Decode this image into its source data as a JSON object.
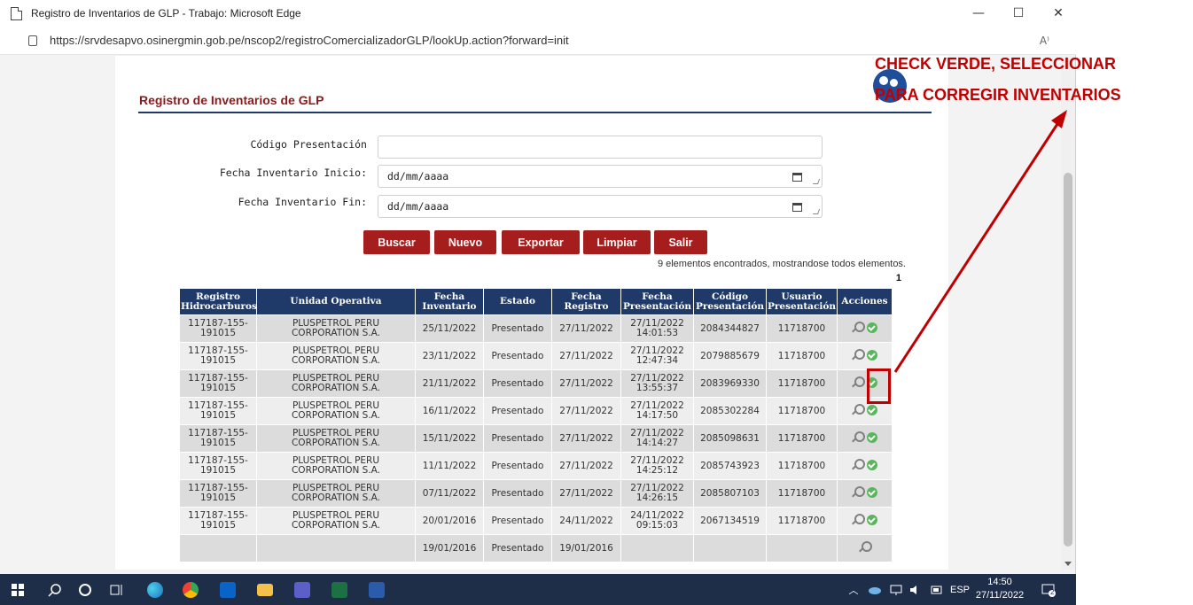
{
  "window": {
    "title": "Registro de Inventarios de GLP - Trabajo: Microsoft Edge",
    "url": "https://srvdesapvo.osinergmin.gob.pe/nscop2/registroComercializadorGLP/lookUp.action?forward=init",
    "minimize": "—",
    "maximize": "☐",
    "close": "✕",
    "read_aloud": "A⁾"
  },
  "page": {
    "heading": "Registro de Inventarios de GLP",
    "form": {
      "codigo_label": "Código Presentación",
      "codigo_value": "",
      "inicio_label": "Fecha Inventario Inicio:",
      "inicio_value": "dd/mm/aaaa",
      "fin_label": "Fecha Inventario Fin:",
      "fin_value": "dd/mm/aaaa"
    },
    "buttons": {
      "buscar": "Buscar",
      "nuevo": "Nuevo",
      "exportar": "Exportar",
      "limpiar": "Limpiar",
      "salir": "Salir"
    },
    "results_message": "9 elementos encontrados, mostrandose todos elementos.",
    "page_number": "1",
    "table": {
      "headers": [
        "Registro Hidrocarburos",
        "Unidad Operativa",
        "Fecha Inventario",
        "Estado",
        "Fecha Registro",
        "Fecha Presentación",
        "Código Presentación",
        "Usuario Presentación",
        "Acciones"
      ],
      "rows": [
        {
          "registro": "117187-155-191015",
          "unidad": "PLUSPETROL PERU CORPORATION S.A.",
          "fecha_inv": "25/11/2022",
          "estado": "Presentado",
          "fecha_reg": "27/11/2022",
          "fecha_pres": "27/11/2022 14:01:53",
          "codigo": "2084344827",
          "usuario": "11718700"
        },
        {
          "registro": "117187-155-191015",
          "unidad": "PLUSPETROL PERU CORPORATION S.A.",
          "fecha_inv": "23/11/2022",
          "estado": "Presentado",
          "fecha_reg": "27/11/2022",
          "fecha_pres": "27/11/2022 12:47:34",
          "codigo": "2079885679",
          "usuario": "11718700"
        },
        {
          "registro": "117187-155-191015",
          "unidad": "PLUSPETROL PERU CORPORATION S.A.",
          "fecha_inv": "21/11/2022",
          "estado": "Presentado",
          "fecha_reg": "27/11/2022",
          "fecha_pres": "27/11/2022 13:55:37",
          "codigo": "2083969330",
          "usuario": "11718700"
        },
        {
          "registro": "117187-155-191015",
          "unidad": "PLUSPETROL PERU CORPORATION S.A.",
          "fecha_inv": "16/11/2022",
          "estado": "Presentado",
          "fecha_reg": "27/11/2022",
          "fecha_pres": "27/11/2022 14:17:50",
          "codigo": "2085302284",
          "usuario": "11718700"
        },
        {
          "registro": "117187-155-191015",
          "unidad": "PLUSPETROL PERU CORPORATION S.A.",
          "fecha_inv": "15/11/2022",
          "estado": "Presentado",
          "fecha_reg": "27/11/2022",
          "fecha_pres": "27/11/2022 14:14:27",
          "codigo": "2085098631",
          "usuario": "11718700"
        },
        {
          "registro": "117187-155-191015",
          "unidad": "PLUSPETROL PERU CORPORATION S.A.",
          "fecha_inv": "11/11/2022",
          "estado": "Presentado",
          "fecha_reg": "27/11/2022",
          "fecha_pres": "27/11/2022 14:25:12",
          "codigo": "2085743923",
          "usuario": "11718700"
        },
        {
          "registro": "117187-155-191015",
          "unidad": "PLUSPETROL PERU CORPORATION S.A.",
          "fecha_inv": "07/11/2022",
          "estado": "Presentado",
          "fecha_reg": "27/11/2022",
          "fecha_pres": "27/11/2022 14:26:15",
          "codigo": "2085807103",
          "usuario": "11718700"
        },
        {
          "registro": "117187-155-191015",
          "unidad": "PLUSPETROL PERU CORPORATION S.A.",
          "fecha_inv": "20/01/2016",
          "estado": "Presentado",
          "fecha_reg": "24/11/2022",
          "fecha_pres": "24/11/2022 09:15:03",
          "codigo": "2067134519",
          "usuario": "11718700"
        },
        {
          "registro": "",
          "unidad": "",
          "fecha_inv": "19/01/2016",
          "estado": "Presentado",
          "fecha_reg": "19/01/2016",
          "fecha_pres": "",
          "codigo": "",
          "usuario": ""
        }
      ]
    }
  },
  "annotation": {
    "line1": "CHECK VERDE, SELECCIONAR",
    "line2": "PARA CORREGIR INVENTARIOS",
    "color": "#c00000"
  },
  "taskbar": {
    "tray_lang": "ESP",
    "time": "14:50",
    "date": "27/11/2022",
    "notifications": "2"
  },
  "colors": {
    "accent": "#a51d1d",
    "header_bg": "#1f3a68",
    "taskbar": "#1f2e48"
  }
}
